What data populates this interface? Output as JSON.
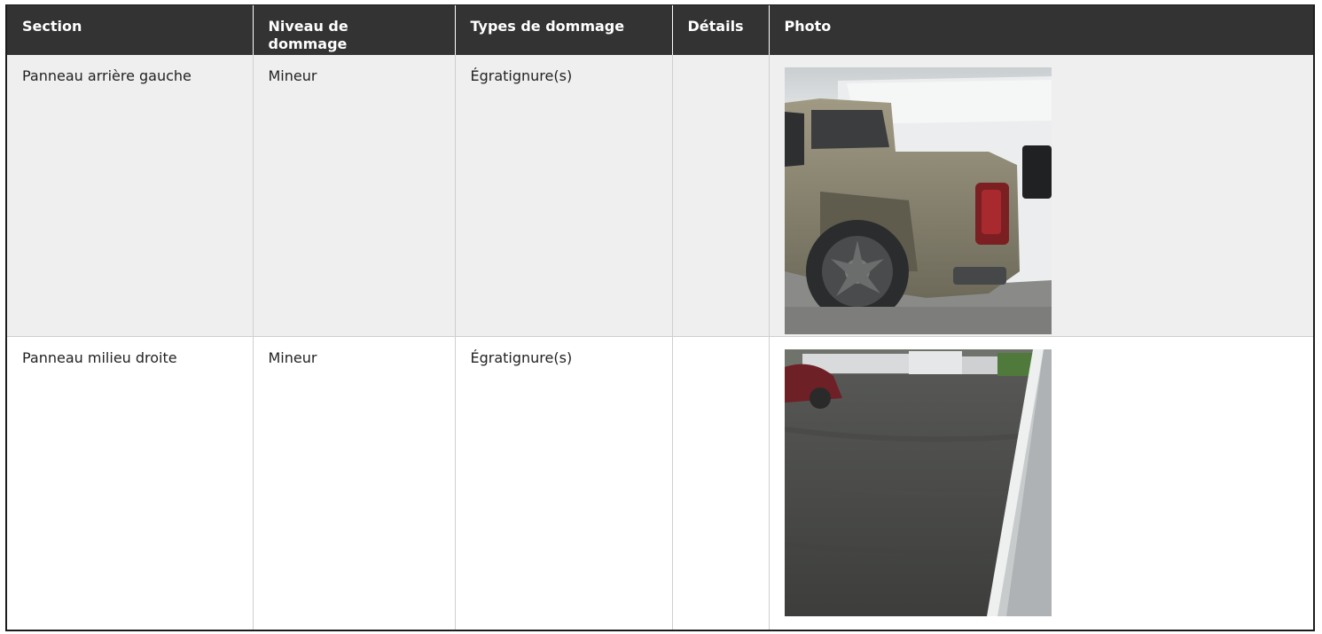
{
  "table": {
    "headers": {
      "section": "Section",
      "niveau": "Niveau de dommage",
      "types": "Types de dommage",
      "details": "Détails",
      "photo": "Photo"
    },
    "rows": [
      {
        "section": "Panneau arrière gauche",
        "niveau": "Mineur",
        "types": "Égratignure(s)",
        "details": ""
      },
      {
        "section": "Panneau milieu droite",
        "niveau": "Mineur",
        "types": "Égratignure(s)",
        "details": ""
      }
    ]
  }
}
